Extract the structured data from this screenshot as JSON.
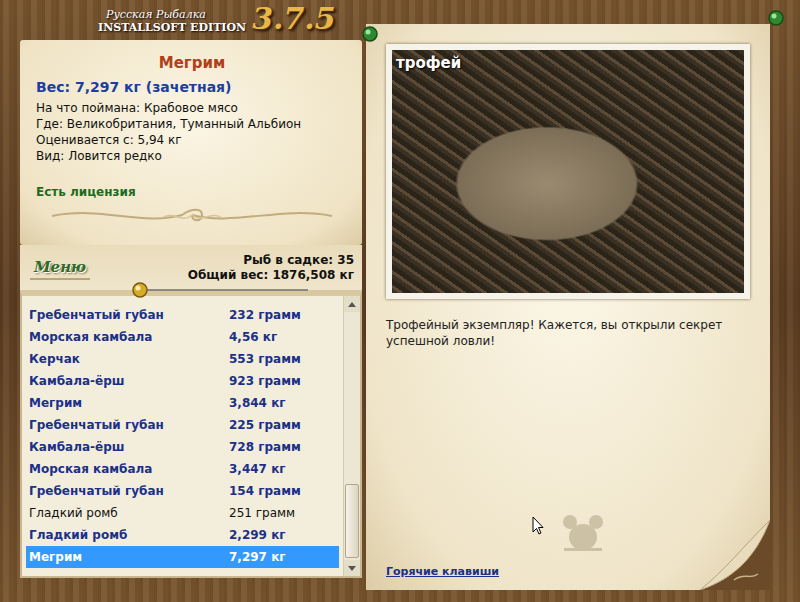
{
  "window": {
    "title_small": "Русская Рыбалка",
    "title_edition": "INSTALLSOFT EDITION",
    "version": "3.7.5"
  },
  "fish_card": {
    "name": "Мегрим",
    "weight": "Вес: 7,297 кг (зачетная)",
    "details": [
      "На что поймана: Крабовое мясо",
      "Где: Великобритания, Туманный Альбион",
      "Оценивается с: 5,94 кг",
      "Вид: Ловится редко"
    ],
    "license": "Есть лицензия"
  },
  "menu_button": "Меню",
  "stats": [
    "Рыб в садке: 35",
    "Общий вес: 1876,508 кг"
  ],
  "catch_list": {
    "scroll_level": 1,
    "rows": [
      {
        "name": "Гребенчатый губан",
        "weight": "232 грамм",
        "counted": true,
        "selected": false
      },
      {
        "name": "Морская камбала",
        "weight": "4,56 кг",
        "counted": true,
        "selected": false
      },
      {
        "name": "Керчак",
        "weight": "553 грамм",
        "counted": true,
        "selected": false
      },
      {
        "name": "Камбала-ёрш",
        "weight": "923 грамм",
        "counted": true,
        "selected": false
      },
      {
        "name": "Мегрим",
        "weight": "3,844 кг",
        "counted": true,
        "selected": false
      },
      {
        "name": "Гребенчатый губан",
        "weight": "225 грамм",
        "counted": true,
        "selected": false
      },
      {
        "name": "Камбала-ёрш",
        "weight": "728 грамм",
        "counted": true,
        "selected": false
      },
      {
        "name": "Морская камбала",
        "weight": "3,447 кг",
        "counted": true,
        "selected": false
      },
      {
        "name": "Гребенчатый губан",
        "weight": "154 грамм",
        "counted": true,
        "selected": false
      },
      {
        "name": "Гладкий ромб",
        "weight": "251 грамм",
        "counted": false,
        "selected": false
      },
      {
        "name": "Гладкий ромб",
        "weight": "2,299 кг",
        "counted": true,
        "selected": false
      },
      {
        "name": "Мегрим",
        "weight": "7,297 кг",
        "counted": true,
        "selected": true
      }
    ]
  },
  "photo": {
    "badge": "трофей"
  },
  "message": "Трофейный экземпляр! Кажется, вы открыли секрет успешной ловли!",
  "hotkeys_link": "Горячие клавиши"
}
